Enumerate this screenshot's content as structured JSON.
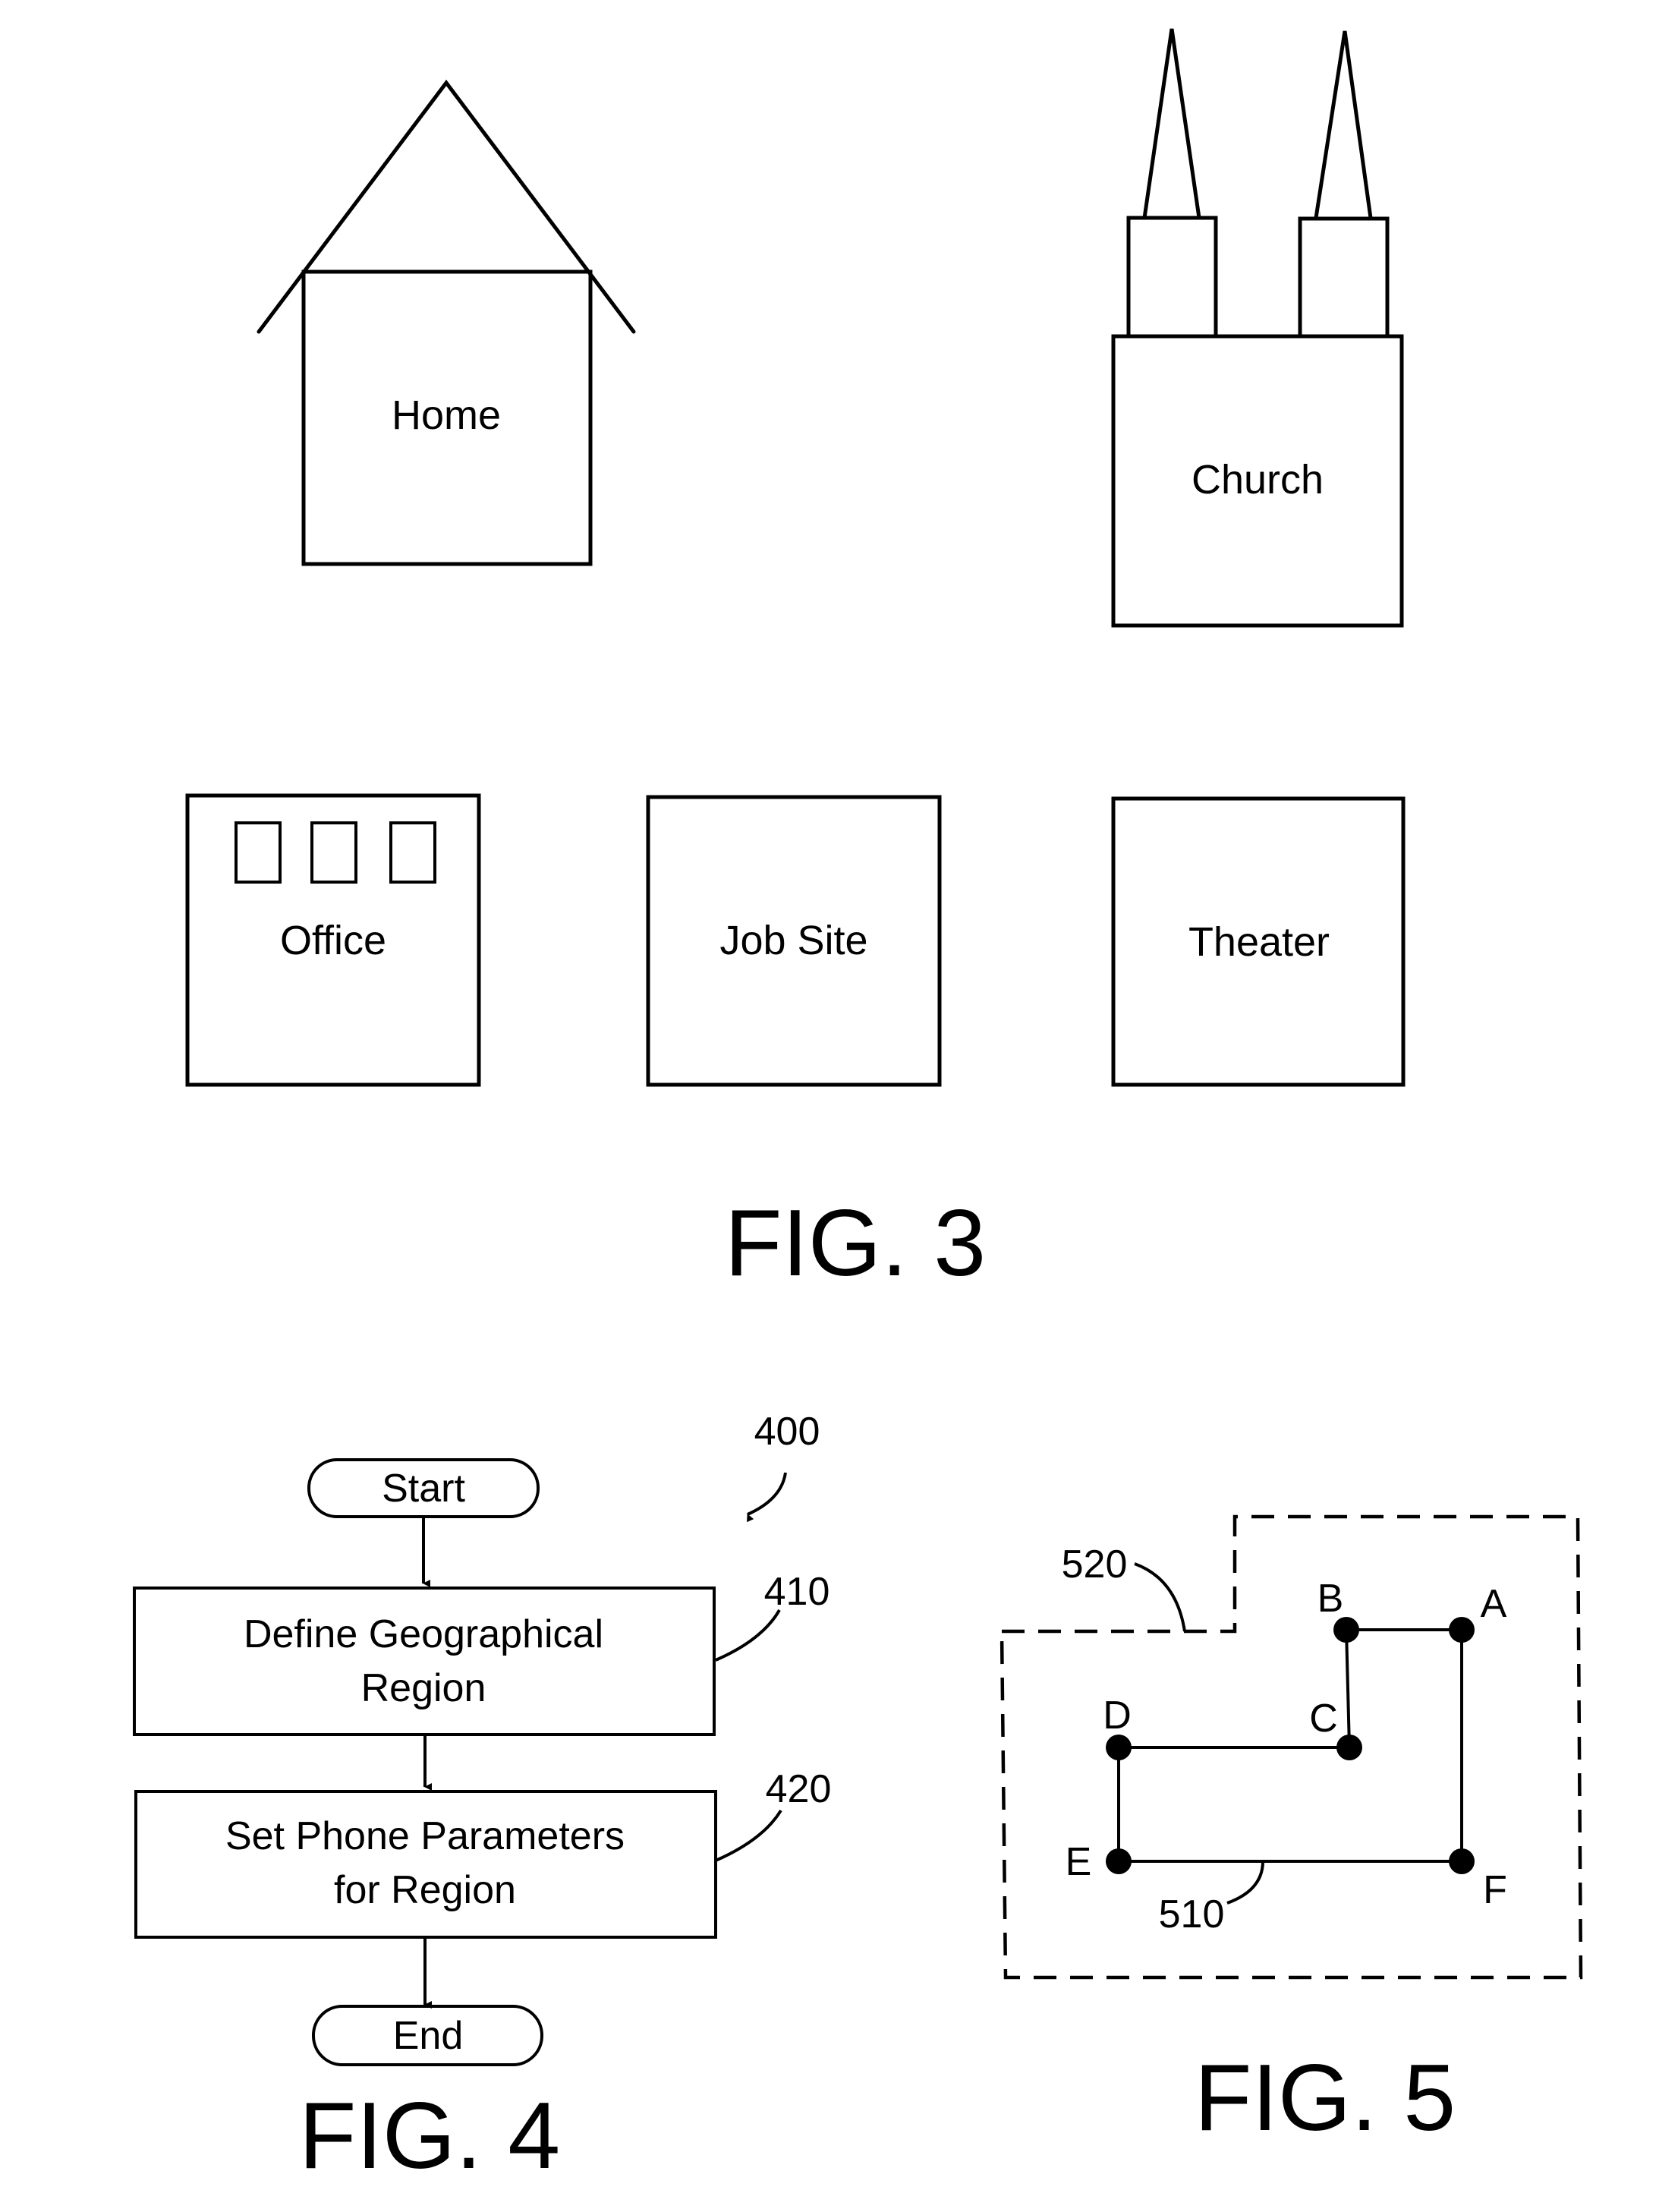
{
  "fig3": {
    "caption": "FIG. 3",
    "locations": {
      "home": "Home",
      "church": "Church",
      "office": "Office",
      "job_site": "Job Site",
      "theater": "Theater"
    }
  },
  "fig4": {
    "caption": "FIG. 4",
    "ref": "400",
    "start": "Start",
    "end": "End",
    "steps": [
      {
        "ref": "410",
        "lines": [
          "Define Geographical",
          "Region"
        ]
      },
      {
        "ref": "420",
        "lines": [
          "Set Phone Parameters",
          "for Region"
        ]
      }
    ]
  },
  "fig5": {
    "caption": "FIG. 5",
    "path_ref": "510",
    "region_ref": "520",
    "points": [
      "A",
      "B",
      "C",
      "D",
      "E",
      "F"
    ]
  }
}
